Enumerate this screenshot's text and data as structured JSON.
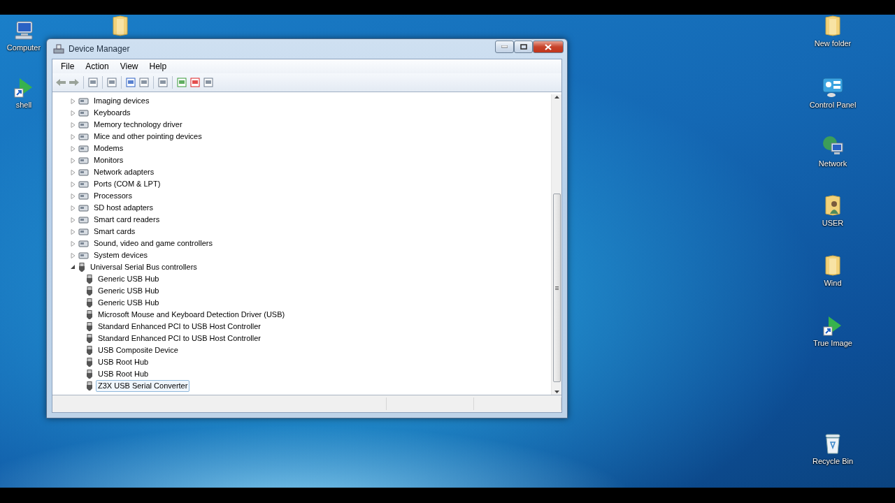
{
  "desktop_icons": [
    {
      "kind": "computer",
      "label": "Computer"
    },
    {
      "kind": "shortcut",
      "label": "shell"
    },
    {
      "kind": "folder"
    },
    {
      "kind": "folder",
      "label": "New folder"
    },
    {
      "kind": "control",
      "label": "Control Panel"
    },
    {
      "kind": "network",
      "label": "Network"
    },
    {
      "kind": "userfolder",
      "label": "USER"
    },
    {
      "kind": "folder",
      "label": "Wind"
    },
    {
      "kind": "shortcut",
      "label": "True Image"
    },
    {
      "kind": "recycle",
      "label": "Recycle Bin"
    }
  ],
  "window": {
    "title": "Device Manager"
  },
  "menu": [
    "File",
    "Action",
    "View",
    "Help"
  ],
  "tree": [
    {
      "label": "Imaging devices",
      "expanded": false,
      "selected": false
    },
    {
      "label": "Keyboards",
      "expanded": false,
      "selected": false
    },
    {
      "label": "Memory technology driver",
      "expanded": false,
      "selected": false
    },
    {
      "label": "Mice and other pointing devices",
      "expanded": false,
      "selected": false
    },
    {
      "label": "Modems",
      "expanded": false,
      "selected": false
    },
    {
      "label": "Monitors",
      "expanded": false,
      "selected": false
    },
    {
      "label": "Network adapters",
      "expanded": false,
      "selected": false
    },
    {
      "label": "Ports (COM & LPT)",
      "expanded": false,
      "selected": false
    },
    {
      "label": "Processors",
      "expanded": false,
      "selected": false
    },
    {
      "label": "SD host adapters",
      "expanded": false,
      "selected": false
    },
    {
      "label": "Smart card readers",
      "expanded": false,
      "selected": false
    },
    {
      "label": "Smart cards",
      "expanded": false,
      "selected": false
    },
    {
      "label": "Sound, video and game controllers",
      "expanded": false,
      "selected": false
    },
    {
      "label": "System devices",
      "expanded": false,
      "selected": false
    },
    {
      "label": "Universal Serial Bus controllers",
      "expanded": true,
      "selected": false,
      "children": [
        {
          "label": "Generic USB Hub",
          "selected": false
        },
        {
          "label": "Generic USB Hub",
          "selected": false
        },
        {
          "label": "Generic USB Hub",
          "selected": false
        },
        {
          "label": "Microsoft Mouse and Keyboard Detection Driver (USB)",
          "selected": false
        },
        {
          "label": "Standard Enhanced PCI to USB Host Controller",
          "selected": false
        },
        {
          "label": "Standard Enhanced PCI to USB Host Controller",
          "selected": false
        },
        {
          "label": "USB Composite Device",
          "selected": false
        },
        {
          "label": "USB Root Hub",
          "selected": false
        },
        {
          "label": "USB Root Hub",
          "selected": false
        },
        {
          "label": "Z3X USB Serial Converter",
          "selected": true
        }
      ]
    }
  ]
}
